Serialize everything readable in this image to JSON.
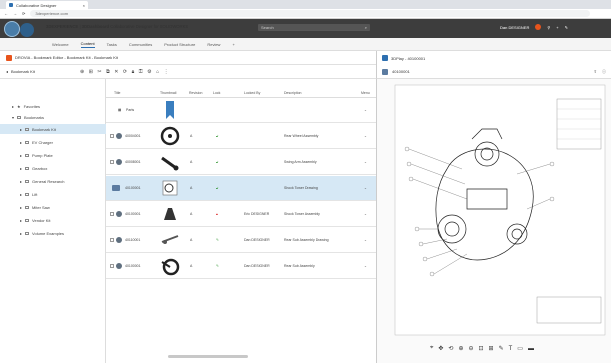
{
  "browser": {
    "tab_title": "Collaborative Designer",
    "url": "3dexperience.com"
  },
  "app": {
    "brand": "3DEXPERIENCE",
    "dashboard": "3DDashboard",
    "product": "Collaborative Designer for SOLIDWORKS",
    "search_placeholder": "Search",
    "user": "Dan DESIGNER"
  },
  "nav_tabs": [
    "Welcome",
    "Content",
    "Tasks",
    "Communities",
    "Product Structure",
    "Review"
  ],
  "left_panel": {
    "title": "DROVIA - Bookmark Editor - Bookmark Kit - Bookmark Kit",
    "breadcrumb": "Bookmark Kit"
  },
  "tree": [
    {
      "label": "Favorites",
      "level": 0
    },
    {
      "label": "Bookmarks",
      "level": 0
    },
    {
      "label": "Bookmark Kit",
      "level": 1,
      "selected": true
    },
    {
      "label": "EV Charger",
      "level": 1
    },
    {
      "label": "Pump Plate",
      "level": 1
    },
    {
      "label": "Gearbox",
      "level": 1
    },
    {
      "label": "General Research",
      "level": 1
    },
    {
      "label": "Lift",
      "level": 1
    },
    {
      "label": "Miter Saw",
      "level": 1
    },
    {
      "label": "Vendor Kit",
      "level": 1
    },
    {
      "label": "Volume Examples",
      "level": 1
    }
  ],
  "table": {
    "headers": [
      "Title",
      "Thumbnail",
      "Revision",
      "Lock",
      "Locked By",
      "Description",
      "Menu"
    ],
    "rows": [
      {
        "title": "Parts",
        "revision": "",
        "locked_by": "",
        "description": ""
      },
      {
        "title": "40004001",
        "revision": "A",
        "locked_by": "",
        "description": "Rear Wheel Assembly"
      },
      {
        "title": "40008001",
        "revision": "A",
        "locked_by": "",
        "description": "Swing Arm Assembly"
      },
      {
        "title": "40100001",
        "revision": "A",
        "locked_by": "",
        "description": "Shock Tower Drawing"
      },
      {
        "title": "40100001",
        "revision": "A",
        "locked_by": "Eric DESIGNER",
        "description": "Shock Tower Assembly"
      },
      {
        "title": "40110001",
        "revision": "A",
        "locked_by": "Dan DESIGNER",
        "description": "Rear Sub Assembly Drawing"
      },
      {
        "title": "40100001",
        "revision": "A",
        "locked_by": "Dan DESIGNER",
        "description": "Rear Sub Assembly"
      }
    ]
  },
  "right_panel": {
    "title": "3DPlay - 40100001",
    "doc_id": "40100001"
  }
}
